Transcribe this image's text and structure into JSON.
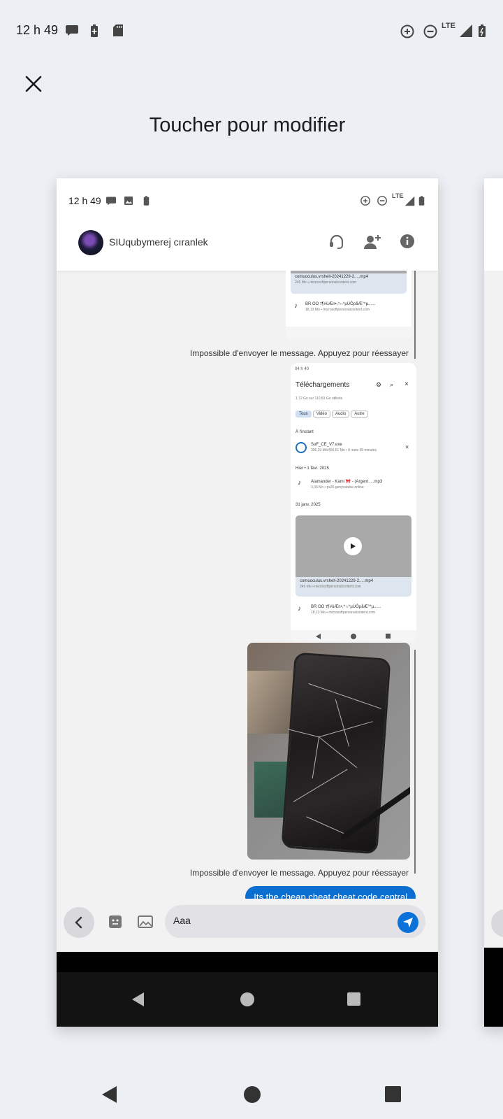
{
  "status_bar": {
    "time": "12 h 49",
    "network": "LTE",
    "icons": [
      "chat-bubble-icon",
      "battery-saver-icon",
      "sd-card-icon",
      "data-saver-icon",
      "do-not-disturb-icon",
      "signal-icon",
      "battery-icon"
    ]
  },
  "editor": {
    "close_icon": "close-icon",
    "title": "Toucher pour modifier"
  },
  "screenshot": {
    "status": {
      "time": "12 h 49",
      "network": "LTE"
    },
    "header": {
      "contact_name": "SIUqubymerej cıranlek",
      "icons": [
        "support-icon",
        "add-person-icon",
        "info-icon"
      ]
    },
    "messages": {
      "error_text_1": "Impossible d'envoyer le message. Appuyez pour réessayer",
      "error_text_2": "Impossible d'envoyer le message. Appuyez pour réessayer",
      "sent_text": "Its the cheap cheat cheat code central"
    },
    "mini_top": {
      "video_caption": "comuoculus.vrshell-20241229-2.....mp4",
      "video_sub": "245 Mo • microsoftpersonalcontent.com",
      "audio_name": "BR OO τ¶#üÆn•,^∩^µÚÔρåÆ°^µ......",
      "audio_sub": "18,13 Mo • microsoftpersonalcontent.com"
    },
    "mini_full": {
      "status": "04 h 40",
      "title": "Téléchargements",
      "storage": "1,72 Go sur 110,83 Go utilisés",
      "chips": [
        "Tous",
        "Vidéo",
        "Audio",
        "Autre"
      ],
      "section_now": "À l'instant",
      "file1_name": "SoF_CE_V7.exe",
      "file1_sub": "306,33 Mo/496,61 Mo • Il reste 35 minutes",
      "section_yesterday": "Hier • 1 févr. 2025",
      "file2_name": "Alamander - Kami 🎀 - (Argent ....mp3",
      "file2_sub": "3,06 Mo • px20.genyoutube.online",
      "section_date": "31 janv. 2025",
      "video_caption": "comuoculus.vrshell-20241229-2.....mp4",
      "video_sub": "245 Mo • microsoftpersonalcontent.com",
      "audio_name": "BR OO τ¶#üÆn•,^∩^µÚÔρåÆ°^µ......",
      "audio_sub": "18,13 Mo • microsoftpersonalcontent.com"
    },
    "composer": {
      "input_value": "Aaa",
      "icons": [
        "back-chevron-icon",
        "sticker-icon",
        "gallery-icon",
        "send-icon"
      ]
    }
  },
  "navigation": {
    "icons": [
      "back-triangle-icon",
      "home-circle-icon",
      "recents-square-icon"
    ]
  }
}
